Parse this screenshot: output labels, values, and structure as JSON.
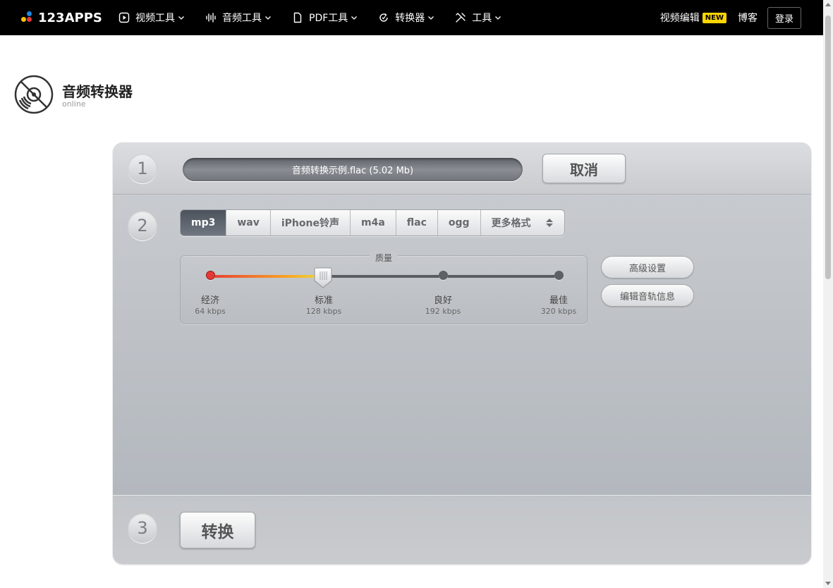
{
  "brand": {
    "logo_text": "123APPS"
  },
  "nav": {
    "items": [
      {
        "label": "视频工具",
        "icon": "play-square-icon"
      },
      {
        "label": "音频工具",
        "icon": "waveform-icon"
      },
      {
        "label": "PDF工具",
        "icon": "document-icon"
      },
      {
        "label": "转换器",
        "icon": "convert-cycle-icon"
      },
      {
        "label": "工具",
        "icon": "tools-icon"
      }
    ],
    "video_editor": "视频编辑",
    "new_badge": "NEW",
    "blog": "博客",
    "login": "登录"
  },
  "app": {
    "title": "音频转换器",
    "subtitle": "online"
  },
  "steps": {
    "one": "1",
    "two": "2",
    "three": "3"
  },
  "file": {
    "name": "音频转换示例.flac (5.02 Mb)"
  },
  "cancel_label": "取消",
  "formats": {
    "tabs": [
      "mp3",
      "wav",
      "iPhone铃声",
      "m4a",
      "flac",
      "ogg",
      "更多格式"
    ],
    "selected": "mp3"
  },
  "quality": {
    "label": "质量",
    "selected_index": 1,
    "stops": [
      {
        "name": "经济",
        "rate": "64 kbps"
      },
      {
        "name": "标准",
        "rate": "128 kbps"
      },
      {
        "name": "良好",
        "rate": "192 kbps"
      },
      {
        "name": "最佳",
        "rate": "320 kbps"
      }
    ]
  },
  "buttons": {
    "advanced": "高级设置",
    "edit_info": "编辑音轨信息",
    "convert": "转换"
  },
  "colors": {
    "accent_new": "#ffd600",
    "active_tab": "#5a606a",
    "slider_start": "#e53935",
    "slider_end": "#e6e043"
  }
}
